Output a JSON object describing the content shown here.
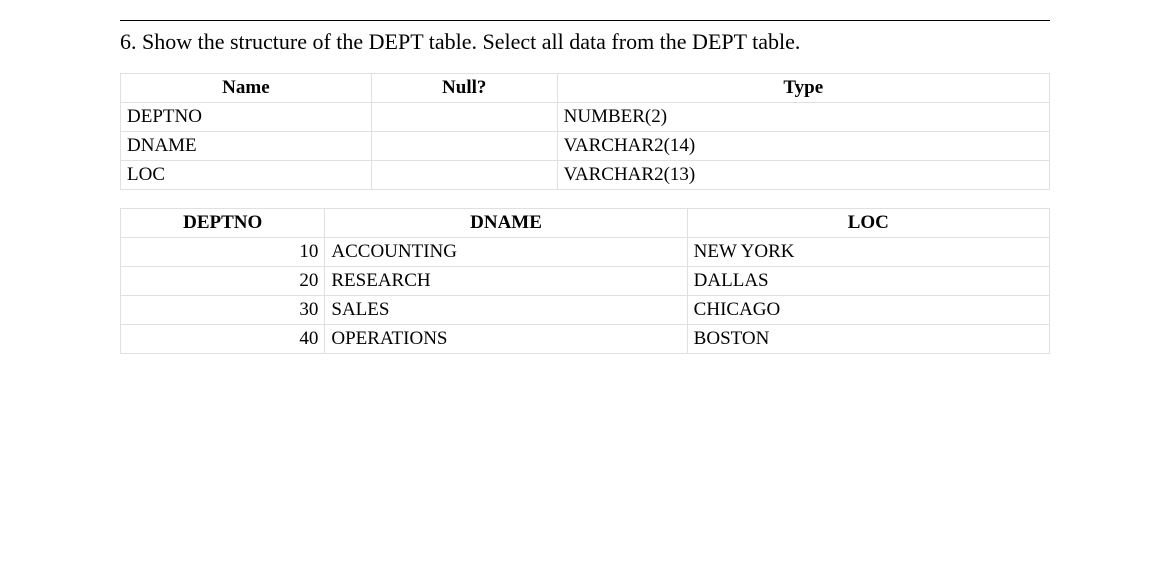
{
  "question": "6. Show the structure of the DEPT table. Select all data from the DEPT table.",
  "structure": {
    "headers": {
      "name": "Name",
      "null": "Null?",
      "type": "Type"
    },
    "rows": [
      {
        "name": "DEPTNO",
        "null": "",
        "type": "NUMBER(2)"
      },
      {
        "name": "DNAME",
        "null": "",
        "type": "VARCHAR2(14)"
      },
      {
        "name": "LOC",
        "null": "",
        "type": "VARCHAR2(13)"
      }
    ]
  },
  "data": {
    "headers": {
      "deptno": "DEPTNO",
      "dname": "DNAME",
      "loc": "LOC"
    },
    "rows": [
      {
        "deptno": "10",
        "dname": "ACCOUNTING",
        "loc": "NEW YORK"
      },
      {
        "deptno": "20",
        "dname": "RESEARCH",
        "loc": "DALLAS"
      },
      {
        "deptno": "30",
        "dname": "SALES",
        "loc": "CHICAGO"
      },
      {
        "deptno": "40",
        "dname": "OPERATIONS",
        "loc": "BOSTON"
      }
    ]
  }
}
